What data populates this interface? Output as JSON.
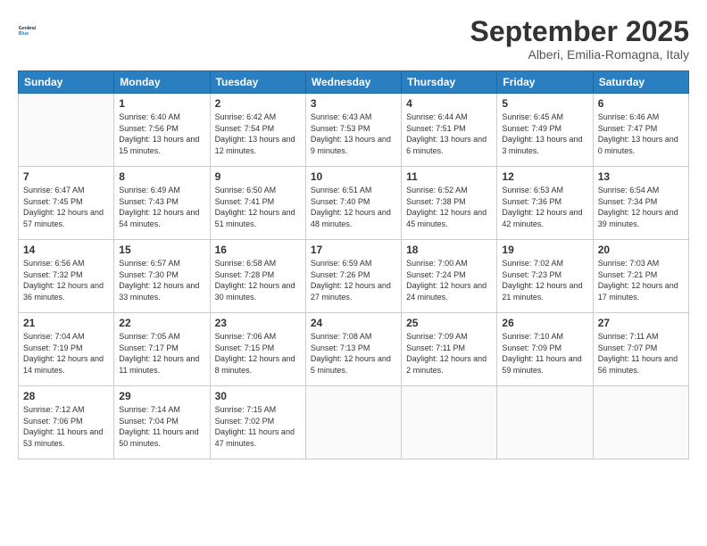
{
  "logo": {
    "general": "General",
    "blue": "Blue"
  },
  "header": {
    "month_title": "September 2025",
    "subtitle": "Alberi, Emilia-Romagna, Italy"
  },
  "days_of_week": [
    "Sunday",
    "Monday",
    "Tuesday",
    "Wednesday",
    "Thursday",
    "Friday",
    "Saturday"
  ],
  "weeks": [
    [
      null,
      {
        "day": 1,
        "sunrise": "6:40 AM",
        "sunset": "7:56 PM",
        "daylight": "13 hours and 15 minutes."
      },
      {
        "day": 2,
        "sunrise": "6:42 AM",
        "sunset": "7:54 PM",
        "daylight": "13 hours and 12 minutes."
      },
      {
        "day": 3,
        "sunrise": "6:43 AM",
        "sunset": "7:53 PM",
        "daylight": "13 hours and 9 minutes."
      },
      {
        "day": 4,
        "sunrise": "6:44 AM",
        "sunset": "7:51 PM",
        "daylight": "13 hours and 6 minutes."
      },
      {
        "day": 5,
        "sunrise": "6:45 AM",
        "sunset": "7:49 PM",
        "daylight": "13 hours and 3 minutes."
      },
      {
        "day": 6,
        "sunrise": "6:46 AM",
        "sunset": "7:47 PM",
        "daylight": "13 hours and 0 minutes."
      }
    ],
    [
      {
        "day": 7,
        "sunrise": "6:47 AM",
        "sunset": "7:45 PM",
        "daylight": "12 hours and 57 minutes."
      },
      {
        "day": 8,
        "sunrise": "6:49 AM",
        "sunset": "7:43 PM",
        "daylight": "12 hours and 54 minutes."
      },
      {
        "day": 9,
        "sunrise": "6:50 AM",
        "sunset": "7:41 PM",
        "daylight": "12 hours and 51 minutes."
      },
      {
        "day": 10,
        "sunrise": "6:51 AM",
        "sunset": "7:40 PM",
        "daylight": "12 hours and 48 minutes."
      },
      {
        "day": 11,
        "sunrise": "6:52 AM",
        "sunset": "7:38 PM",
        "daylight": "12 hours and 45 minutes."
      },
      {
        "day": 12,
        "sunrise": "6:53 AM",
        "sunset": "7:36 PM",
        "daylight": "12 hours and 42 minutes."
      },
      {
        "day": 13,
        "sunrise": "6:54 AM",
        "sunset": "7:34 PM",
        "daylight": "12 hours and 39 minutes."
      }
    ],
    [
      {
        "day": 14,
        "sunrise": "6:56 AM",
        "sunset": "7:32 PM",
        "daylight": "12 hours and 36 minutes."
      },
      {
        "day": 15,
        "sunrise": "6:57 AM",
        "sunset": "7:30 PM",
        "daylight": "12 hours and 33 minutes."
      },
      {
        "day": 16,
        "sunrise": "6:58 AM",
        "sunset": "7:28 PM",
        "daylight": "12 hours and 30 minutes."
      },
      {
        "day": 17,
        "sunrise": "6:59 AM",
        "sunset": "7:26 PM",
        "daylight": "12 hours and 27 minutes."
      },
      {
        "day": 18,
        "sunrise": "7:00 AM",
        "sunset": "7:24 PM",
        "daylight": "12 hours and 24 minutes."
      },
      {
        "day": 19,
        "sunrise": "7:02 AM",
        "sunset": "7:23 PM",
        "daylight": "12 hours and 21 minutes."
      },
      {
        "day": 20,
        "sunrise": "7:03 AM",
        "sunset": "7:21 PM",
        "daylight": "12 hours and 17 minutes."
      }
    ],
    [
      {
        "day": 21,
        "sunrise": "7:04 AM",
        "sunset": "7:19 PM",
        "daylight": "12 hours and 14 minutes."
      },
      {
        "day": 22,
        "sunrise": "7:05 AM",
        "sunset": "7:17 PM",
        "daylight": "12 hours and 11 minutes."
      },
      {
        "day": 23,
        "sunrise": "7:06 AM",
        "sunset": "7:15 PM",
        "daylight": "12 hours and 8 minutes."
      },
      {
        "day": 24,
        "sunrise": "7:08 AM",
        "sunset": "7:13 PM",
        "daylight": "12 hours and 5 minutes."
      },
      {
        "day": 25,
        "sunrise": "7:09 AM",
        "sunset": "7:11 PM",
        "daylight": "12 hours and 2 minutes."
      },
      {
        "day": 26,
        "sunrise": "7:10 AM",
        "sunset": "7:09 PM",
        "daylight": "11 hours and 59 minutes."
      },
      {
        "day": 27,
        "sunrise": "7:11 AM",
        "sunset": "7:07 PM",
        "daylight": "11 hours and 56 minutes."
      }
    ],
    [
      {
        "day": 28,
        "sunrise": "7:12 AM",
        "sunset": "7:06 PM",
        "daylight": "11 hours and 53 minutes."
      },
      {
        "day": 29,
        "sunrise": "7:14 AM",
        "sunset": "7:04 PM",
        "daylight": "11 hours and 50 minutes."
      },
      {
        "day": 30,
        "sunrise": "7:15 AM",
        "sunset": "7:02 PM",
        "daylight": "11 hours and 47 minutes."
      },
      null,
      null,
      null,
      null
    ]
  ]
}
